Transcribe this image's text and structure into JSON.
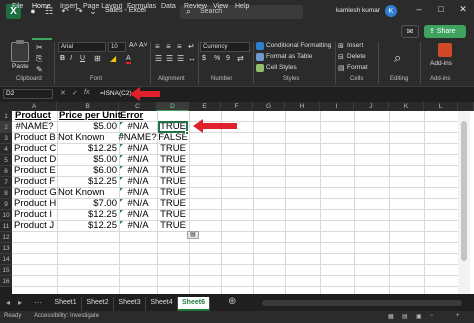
{
  "window": {
    "title": "Sales  -  Excel",
    "user": "kamlesh kumar",
    "avatar_initial": "K"
  },
  "search": {
    "placeholder": "Search"
  },
  "quick_access": {
    "autosave": "●",
    "save": "☷",
    "undo": "↶",
    "redo": "↷",
    "more": "⌄"
  },
  "ribbon_tabs": [
    "File",
    "Home",
    "Insert",
    "Page Layout",
    "Formulas",
    "Data",
    "Review",
    "View",
    "Help"
  ],
  "share_label": "Share",
  "ribbon": {
    "clipboard": {
      "paste": "Paste",
      "label": "Clipboard"
    },
    "font": {
      "name": "Arial",
      "size": "10",
      "bold": "B",
      "italic": "I",
      "underline": "U",
      "grow": "A˄",
      "shrink": "A˅",
      "font_color": "A",
      "label": "Font"
    },
    "alignment": {
      "label": "Alignment"
    },
    "number": {
      "format": "Currency",
      "currency": "$",
      "percent": "%",
      "comma": "9",
      "label": "Number"
    },
    "styles": {
      "conditional": "Conditional Formatting",
      "format_table": "Format as Table",
      "cell_styles": "Cell Styles",
      "label": "Styles"
    },
    "cells": {
      "insert": "Insert",
      "delete": "Delete",
      "format": "Format",
      "label": "Cells"
    },
    "editing": {
      "label": "Editing"
    },
    "addins": {
      "title": "Add-ins",
      "label": "Add-ins"
    }
  },
  "formula_bar": {
    "name_box": "D2",
    "formula": "=ISNA(C2)",
    "fx": "fx"
  },
  "grid": {
    "columns": [
      "A",
      "B",
      "C",
      "D",
      "E",
      "F",
      "G",
      "H",
      "I",
      "J",
      "K",
      "L"
    ],
    "rows": [
      "1",
      "2",
      "3",
      "4",
      "5",
      "6",
      "7",
      "8",
      "9",
      "10",
      "11",
      "12",
      "13",
      "14",
      "15",
      "16"
    ],
    "header_row": {
      "a": "Product",
      "b": "Price per Unit",
      "c": "Error"
    },
    "data": [
      {
        "a": "#NAME?",
        "b": "$5.00",
        "c": "#N/A",
        "d": "TRUE"
      },
      {
        "a": "Product B",
        "b": "Not Known",
        "c": "#NAME?",
        "d": "FALSE"
      },
      {
        "a": "Product C",
        "b": "$12.25",
        "c": "#N/A",
        "d": "TRUE"
      },
      {
        "a": "Product D",
        "b": "$5.00",
        "c": "#N/A",
        "d": "TRUE"
      },
      {
        "a": "Product E",
        "b": "$6.00",
        "c": "#N/A",
        "d": "TRUE"
      },
      {
        "a": "Product F",
        "b": "$12.25",
        "c": "#N/A",
        "d": "TRUE"
      },
      {
        "a": "Product G",
        "b": "Not Known",
        "c": "#N/A",
        "d": "TRUE"
      },
      {
        "a": "Product H",
        "b": "$7.00",
        "c": "#N/A",
        "d": "TRUE"
      },
      {
        "a": "Product I",
        "b": "$12.25",
        "c": "#N/A",
        "d": "TRUE"
      },
      {
        "a": "Product J",
        "b": "$12.25",
        "c": "#N/A",
        "d": "TRUE"
      }
    ]
  },
  "sheets": [
    "Sheet1",
    "Sheet2",
    "Sheet3",
    "Sheet4",
    "Sheet6"
  ],
  "active_sheet": "Sheet6",
  "status": {
    "ready": "Ready",
    "accessibility": "Accessibility: Investigate"
  },
  "colors": {
    "excel_green": "#217346",
    "accent_green": "#3fa35f",
    "arrow_red": "#e0202a"
  }
}
